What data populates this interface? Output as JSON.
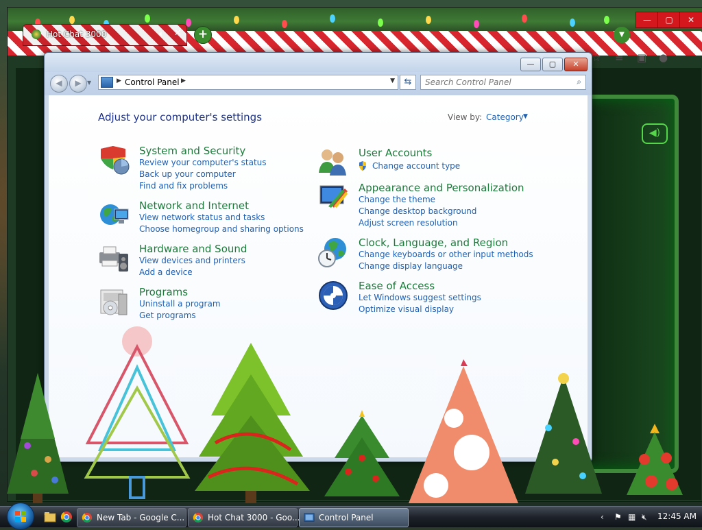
{
  "chrome": {
    "tab_title": "Hot Chat 3000",
    "tab_audio_icon": "speaker-icon",
    "tab_close": "✕",
    "new_tab_label": "+",
    "winctrls": [
      "—",
      "▢",
      "✕"
    ],
    "theme_colors": {
      "stripe_red": "#d7262d",
      "green": "#3a8a2e"
    }
  },
  "control_panel": {
    "window_controls": [
      "—",
      "▢",
      "✕"
    ],
    "address": {
      "crumb": "Control Panel"
    },
    "search": {
      "placeholder": "Search Control Panel"
    },
    "heading": "Adjust your computer's settings",
    "view_by": {
      "label": "View by:",
      "value": "Category"
    },
    "categories_left": [
      {
        "title": "System and Security",
        "icon": "system-security-icon",
        "links": [
          "Review your computer's status",
          "Back up your computer",
          "Find and fix problems"
        ]
      },
      {
        "title": "Network and Internet",
        "icon": "network-internet-icon",
        "links": [
          "View network status and tasks",
          "Choose homegroup and sharing options"
        ]
      },
      {
        "title": "Hardware and Sound",
        "icon": "hardware-sound-icon",
        "links": [
          "View devices and printers",
          "Add a device"
        ]
      },
      {
        "title": "Programs",
        "icon": "programs-icon",
        "links": [
          "Uninstall a program",
          "Get programs"
        ]
      }
    ],
    "categories_right": [
      {
        "title": "User Accounts",
        "icon": "user-accounts-icon",
        "links": [
          "Change account type"
        ]
      },
      {
        "title": "Appearance and Personalization",
        "icon": "appearance-icon",
        "links": [
          "Change the theme",
          "Change desktop background",
          "Adjust screen resolution"
        ]
      },
      {
        "title": "Clock, Language, and Region",
        "icon": "clock-globe-icon",
        "links": [
          "Change keyboards or other input methods",
          "Change display language"
        ]
      },
      {
        "title": "Ease of Access",
        "icon": "ease-of-access-icon",
        "links": [
          "Let Windows suggest settings",
          "Optimize visual display"
        ]
      }
    ]
  },
  "taskbar": {
    "buttons": [
      {
        "label": "New Tab - Google C...",
        "icon": "chrome-icon"
      },
      {
        "label": "Hot Chat 3000 - Goo...",
        "icon": "chrome-icon"
      },
      {
        "label": "Control Panel",
        "icon": "control-panel-icon"
      }
    ],
    "clock": "12:45 AM"
  }
}
